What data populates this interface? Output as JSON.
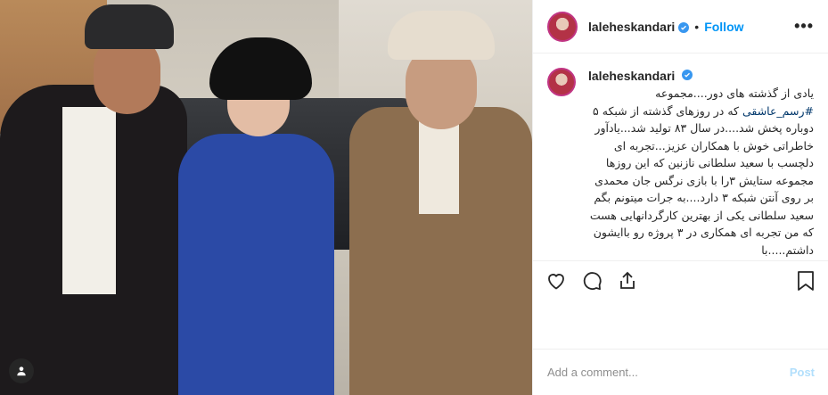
{
  "post": {
    "username": "laleheskandari",
    "follow_label": "Follow",
    "separator": "•",
    "more_label": "•••"
  },
  "caption": {
    "username": "laleheskandari",
    "text_before_tag": "یادی از گذشته های دور....مجموعه ",
    "hashtag": "#رسم_عاشقی",
    "text_after_tag": " که در روزهای گذشته از شبکه ۵ دوباره پخش شد....در سال ۸۳ تولید شد...یادآور خاطراتی خوش با همکاران عزیز...تجربه ای دلچسب با سعید سلطانی نازنین که این روزها مجموعه ستایش ۳را با بازی نرگس جان محمدی بر روی آنتن شبکه ۳ دارد....به جرات میتونم بگم سعید سلطانی یکی از بهترین کارگردانهایی هست که من تجربه ای همکاری در ۳ پروژه رو باایشون داشتم.....با"
  },
  "comment": {
    "placeholder": "Add a comment...",
    "post_label": "Post"
  },
  "icons": {
    "like": "heart-icon",
    "comment": "comment-icon",
    "share": "share-icon",
    "save": "bookmark-icon",
    "verified": "verified-badge-icon",
    "user_tag": "user-tag-icon"
  },
  "colors": {
    "link": "#0095f6",
    "hashtag": "#00376b",
    "post_disabled": "#b2dffc",
    "avatar_ring": "#c13584"
  }
}
